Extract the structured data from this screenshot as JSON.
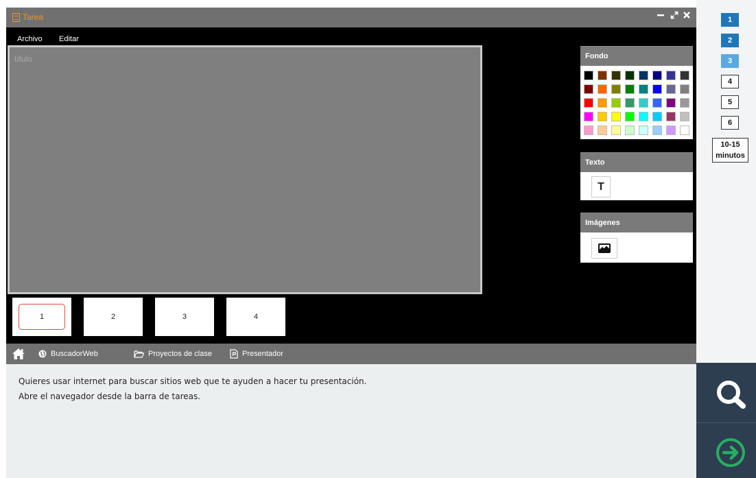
{
  "window": {
    "title": "Tarea",
    "controls": {
      "minimize": "minimize-icon",
      "maximize": "expand-icon",
      "close": "close-icon"
    }
  },
  "menu": {
    "archivo": "Archivo",
    "editar": "Editar"
  },
  "canvas": {
    "title_placeholder": "título"
  },
  "thumbnails": [
    "1",
    "2",
    "3",
    "4"
  ],
  "active_slide": 1,
  "panels": {
    "fondo": {
      "title": "Fondo"
    },
    "texto": {
      "title": "Texto",
      "tool_label": "T"
    },
    "imagenes": {
      "title": "Imágenes"
    }
  },
  "palette": [
    [
      "#000000",
      "#7f3300",
      "#333300",
      "#003300",
      "#003366",
      "#000080",
      "#333399",
      "#333333"
    ],
    [
      "#800000",
      "#ff6600",
      "#808000",
      "#008000",
      "#008080",
      "#0000ff",
      "#666699",
      "#808080"
    ],
    [
      "#ff0000",
      "#ff9900",
      "#99cc00",
      "#339966",
      "#33cccc",
      "#3366ff",
      "#800080",
      "#999999"
    ],
    [
      "#ff00ff",
      "#ffcc00",
      "#ffff00",
      "#00ff00",
      "#00ffff",
      "#00ccff",
      "#993366",
      "#c0c0c0"
    ],
    [
      "#ff99cc",
      "#ffcc99",
      "#ffff99",
      "#ccffcc",
      "#ccffff",
      "#99ccff",
      "#cc99ff",
      "#ffffff"
    ]
  ],
  "taskbar": {
    "browser": "BuscadorWeb",
    "projects": "Proyectos de clase",
    "presenter": "Presentador"
  },
  "instructions": {
    "line1": "Quieres usar internet para buscar sitios web que te ayuden a hacer tu presentación.",
    "line2": "Abre el navegador desde la barra de tareas."
  },
  "steps": [
    {
      "label": "1",
      "state": "done"
    },
    {
      "label": "2",
      "state": "done"
    },
    {
      "label": "3",
      "state": "current"
    },
    {
      "label": "4",
      "state": "pending"
    },
    {
      "label": "5",
      "state": "pending"
    },
    {
      "label": "6",
      "state": "pending"
    }
  ],
  "time_estimate": {
    "line1": "10-15",
    "line2": "minutos"
  },
  "colors": {
    "accent_orange": "#f7941d",
    "step_done": "#1f77b8",
    "step_current": "#5ba9e0",
    "nav_dark": "#2c3e50",
    "next_green": "#27ae60"
  }
}
